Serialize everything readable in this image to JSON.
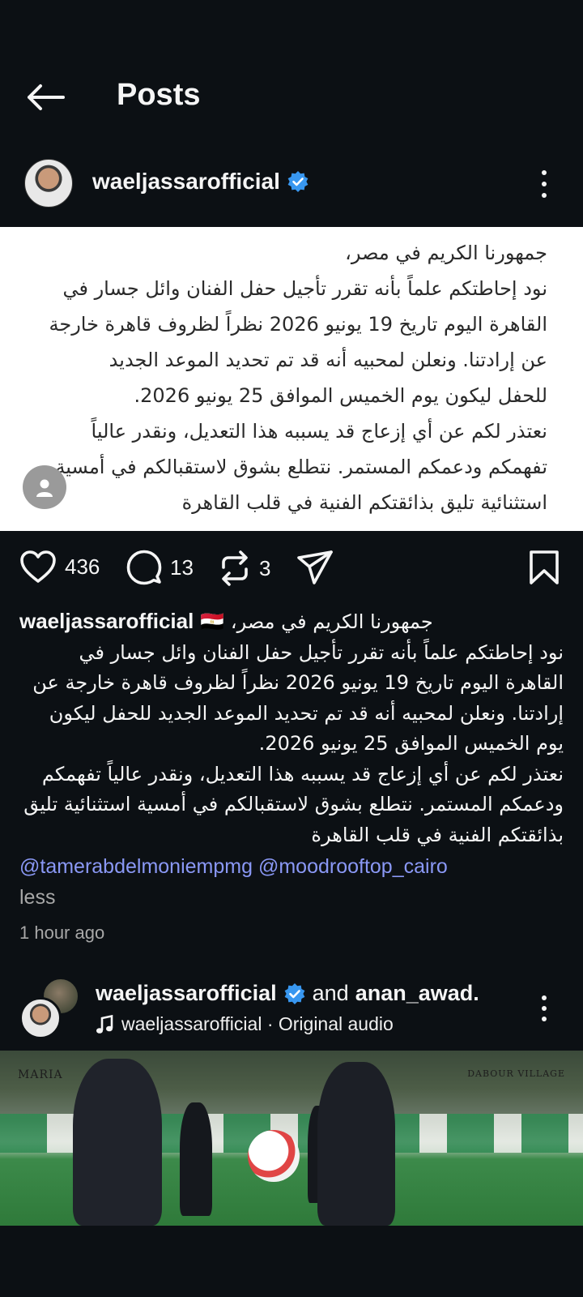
{
  "header": {
    "title": "Posts",
    "back_icon": "arrow-left-icon"
  },
  "post": {
    "username": "waeljassarofficial",
    "verified": true,
    "image_text": "جمهورنا الكريم في مصر،\nنود إحاطتكم علماً بأنه تقرر تأجيل حفل الفنان وائل جسار في\nالقاهرة اليوم تاريخ 19 يونيو 2026 نظراً لظروف قاهرة خارجة\nعن إرادتنا. ونعلن لمحبيه أنه قد تم تحديد الموعد الجديد\nللحفل ليكون يوم الخميس الموافق 25 يونيو 2026.\nنعتذر لكم عن أي إزعاج قد يسببه هذا التعديل، ونقدر عالياً\nتفهمكم ودعمكم المستمر. نتطلع بشوق لاستقبالكم في أمسية\nاستثنائية تليق بذائقتكم الفنية في قلب القاهرة",
    "actions": {
      "likes": "436",
      "comments": "13",
      "reposts": "3"
    },
    "caption": {
      "user": "waeljassarofficial",
      "first_line": "جمهورنا الكريم في مصر، 🇪🇬",
      "body": "نود إحاطتكم علماً بأنه تقرر تأجيل حفل الفنان وائل جسار في\nالقاهرة اليوم تاريخ 19 يونيو 2026 نظراً لظروف قاهرة خارجة عن\nإرادتنا. ونعلن لمحبيه أنه قد تم تحديد الموعد الجديد للحفل ليكون\nيوم الخميس الموافق 25 يونيو 2026.\nنعتذر لكم عن أي إزعاج قد يسببه هذا التعديل، ونقدر عالياً تفهمكم\nودعمكم المستمر. نتطلع بشوق لاستقبالكم في أمسية استثنائية تليق\nبذائقتكم الفنية في قلب القاهرة",
      "mention_1": "@tamerabdelmoniempmg",
      "mention_2": "@moodrooftop_cairo",
      "less": "less"
    },
    "time": "1 hour ago"
  },
  "post2": {
    "user": "waeljassarofficial",
    "and": "and",
    "collaborator": "anan_awad.",
    "audio": "waeljassarofficial · Original audio",
    "brand_left": "MARIA",
    "brand_right": "DABOUR VILLAGE"
  },
  "colors": {
    "background": "#0c1014",
    "verified": "#3897f0",
    "mention": "#8a98f5",
    "muted": "#a8a8a8"
  }
}
